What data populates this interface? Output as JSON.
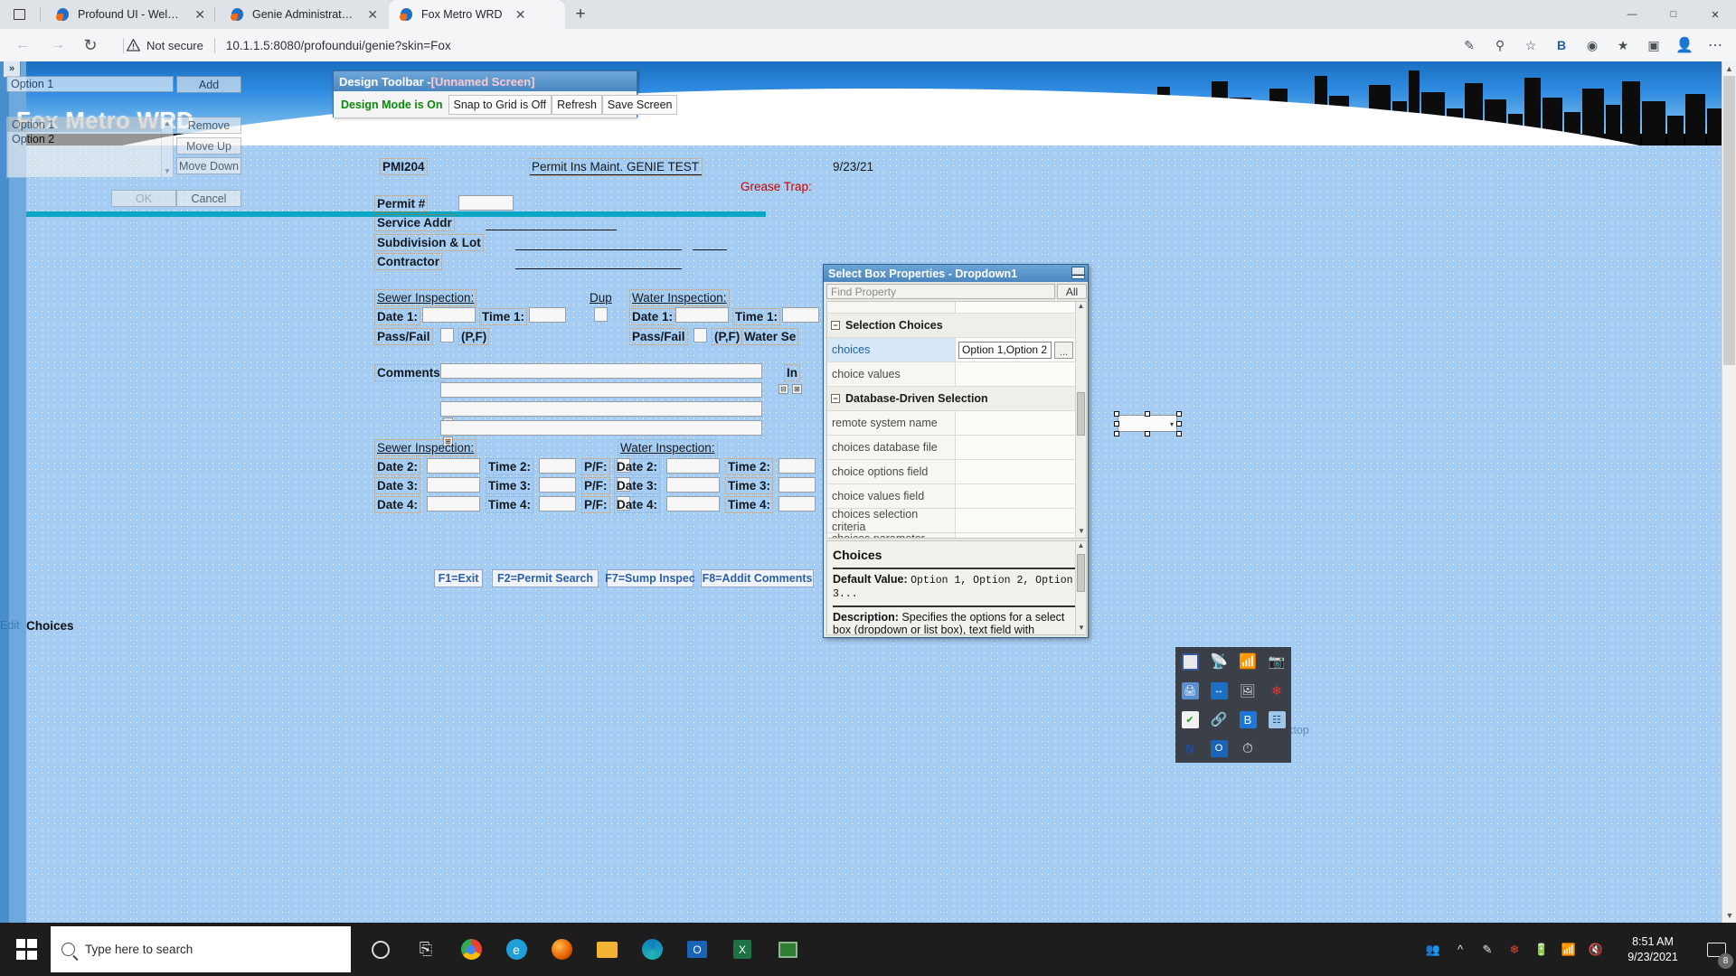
{
  "browser": {
    "tabs": [
      {
        "title": "Profound UI - Welcome Page",
        "close": "✕",
        "active": false
      },
      {
        "title": "Genie Administration",
        "close": "✕",
        "active": false
      },
      {
        "title": "Fox Metro WRD",
        "close": "✕",
        "active": true
      }
    ],
    "new_tab": "+",
    "window_controls": {
      "minimize": "—",
      "maximize": "□",
      "close": "✕"
    },
    "nav": {
      "back": "←",
      "forward": "→",
      "reload": "↻"
    },
    "security_label": "Not secure",
    "url": "10.1.1.5:8080/profoundui/genie?skin=Fox",
    "toolbar_icons": [
      "pen-icon",
      "zoom-icon",
      "favorite-add-icon",
      "bing-icon",
      "collections-globe-icon",
      "favorites-icon",
      "collections-icon",
      "profile-icon",
      "settings-more-icon"
    ],
    "bing_label": "B"
  },
  "page": {
    "banner_title": "Fox Metro WRD",
    "expand_rail_icon": "»"
  },
  "design_toolbar": {
    "title_prefix": "Design Toolbar - ",
    "title_screen": "[Unnamed Screen]",
    "buttons": [
      {
        "label": "Design Mode is On",
        "state": "on"
      },
      {
        "label": "Snap to Grid is Off",
        "state": "off"
      },
      {
        "label": "Refresh",
        "state": "off"
      },
      {
        "label": "Save Screen",
        "state": "off"
      }
    ]
  },
  "choices_dialog": {
    "input_value": "Option 1",
    "list_items": [
      "Option 1",
      "Option 2"
    ],
    "selected_index": 0,
    "buttons": {
      "add": "Add",
      "remove": "Remove",
      "move_up": "Move Up",
      "move_down": "Move Down",
      "ok": "OK",
      "cancel": "Cancel"
    },
    "edit_label": "Edit",
    "title_label": "Choices",
    "scroll_up": "▲",
    "scroll_down": "▼"
  },
  "form": {
    "program_id": "PMI204",
    "screen_title": "Permit Ins Maint. GENIE TEST",
    "date": "9/23/21",
    "grease_trap": "Grease Trap:",
    "fields": [
      {
        "label": "Permit #"
      },
      {
        "label": "Service Addr"
      },
      {
        "label": "Subdivision & Lot"
      },
      {
        "label": "Contractor"
      }
    ],
    "sewer_header_1": "Sewer Inspection:",
    "water_header_1": "Water Inspection:",
    "dup_label": "Dup",
    "row1": {
      "date": "Date 1:",
      "time": "Time 1:"
    },
    "pass_fail_label": "Pass/Fail",
    "pf_hint": "(P,F)",
    "water_se": "Water Se",
    "comments_label": "Comments:",
    "in_label": "In",
    "sewer_header_2": "Sewer Inspection:",
    "water_header_2": "Water Inspection:",
    "rows2": [
      {
        "date": "Date 2:",
        "time": "Time 2:",
        "pf": "P/F:"
      },
      {
        "date": "Date 3:",
        "time": "Time 3:",
        "pf": "P/F:"
      },
      {
        "date": "Date 4:",
        "time": "Time 4:",
        "pf": "P/F:"
      }
    ],
    "water_rows2": [
      {
        "date": "Date 2:",
        "time": "Time 2:"
      },
      {
        "date": "Date 3:",
        "time": "Time 3:"
      },
      {
        "date": "Date 4:",
        "time": "Time 4:"
      }
    ],
    "function_keys": [
      "F1=Exit",
      "F2=Permit Search",
      "F7=Sump Inspec",
      "F8=Addit Comments"
    ],
    "save_desktop": "Save Desktop"
  },
  "properties_window": {
    "title": "Select Box Properties - Dropdown1",
    "minimize_icon": "—",
    "find_placeholder": "Find Property",
    "all_button": "All",
    "categories": [
      {
        "name": "Selection Choices",
        "collapse_icon": "−",
        "rows": [
          {
            "key": "choices",
            "value": "Option 1,Option 2",
            "selected": true,
            "has_editor": true,
            "editor_button": "..."
          },
          {
            "key": "choice values",
            "value": "",
            "selected": false,
            "has_editor": false
          }
        ]
      },
      {
        "name": "Database-Driven Selection",
        "collapse_icon": "−",
        "rows": [
          {
            "key": "remote system name",
            "value": "",
            "selected": false,
            "has_editor": false
          },
          {
            "key": "choices database file",
            "value": "",
            "selected": false,
            "has_editor": false
          },
          {
            "key": "choice options field",
            "value": "",
            "selected": false,
            "has_editor": false
          },
          {
            "key": "choice values field",
            "value": "",
            "selected": false,
            "has_editor": false
          },
          {
            "key": "choices selection criteria",
            "value": "",
            "selected": false,
            "has_editor": false
          },
          {
            "key": "choices parameter value",
            "value": "",
            "selected": false,
            "has_editor": false
          }
        ]
      }
    ],
    "scroll_up": "▲",
    "scroll_down": "▼",
    "description_panel": {
      "heading": "Choices",
      "default_value_label": "Default Value:",
      "default_value": "Option 1, Option 2, Option 3...",
      "description_label": "Description:",
      "description_text": "Specifies the options for a select box (dropdown or list box), text field with autocomplete"
    }
  },
  "canvas_widget": {
    "name": "dropdown-widget",
    "dropdown_arrow": "▾"
  },
  "tray_panel": {
    "icons": [
      "remote-display-icon",
      "satellite-dish-icon",
      "wifi-green-icon",
      "webcam-icon",
      "printer-blue-icon",
      "teamviewer-icon",
      "fax-scanner-icon",
      "red-cluster-icon",
      "windows-security-icon",
      "link-chain-icon",
      "bluetooth-icon",
      "network-map-icon",
      "nx-icon",
      "outlook-icon",
      "power-clock-icon"
    ]
  },
  "taskbar": {
    "search_placeholder": "Type here to search",
    "pinned": [
      "cortana-circle-icon",
      "task-view-icon",
      "chrome-icon",
      "edge-legacy-icon",
      "firefox-icon",
      "file-explorer-icon",
      "edge-icon",
      "outlook-icon",
      "excel-icon",
      "ibm-terminal-icon"
    ],
    "tray_icons": [
      "people-icon",
      "show-hidden-icon",
      "pen-tablet-icon",
      "ccleaner-icon",
      "battery-icon",
      "network-icon",
      "volume-muted-icon"
    ],
    "time": "8:51 AM",
    "date": "9/23/2021",
    "notification_count": "8"
  },
  "colors": {
    "page_bg": "#a5cdf3",
    "accent_blue": "#4a86c0",
    "design_on_green": "#0a8a0a",
    "grease_trap_red": "#cc0000",
    "fkey_text": "#2a5fa8"
  }
}
